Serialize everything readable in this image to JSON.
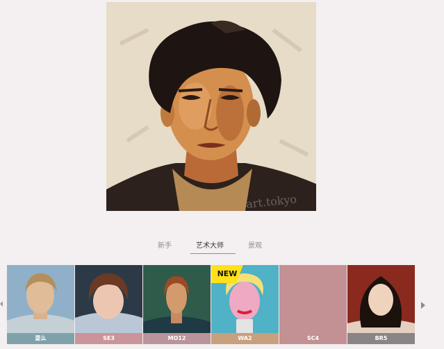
{
  "preview": {
    "signature": "art.tokyo"
  },
  "tabs": [
    {
      "label": "新手",
      "active": false
    },
    {
      "label": "艺术大师",
      "active": true
    },
    {
      "label": "景观",
      "active": false
    }
  ],
  "styles": [
    {
      "label": "耍么",
      "caption_color": "#7fa2aa",
      "badge": ""
    },
    {
      "label": "SE3",
      "caption_color": "#c9949a",
      "badge": ""
    },
    {
      "label": "MO12",
      "caption_color": "#b9949a",
      "badge": ""
    },
    {
      "label": "WA2",
      "caption_color": "#c8a07e",
      "badge": "NEW"
    },
    {
      "label": "SC4",
      "caption_color": "#c39093",
      "badge": ""
    },
    {
      "label": "BR5",
      "caption_color": "#8a8584",
      "badge": ""
    }
  ],
  "colors": {
    "accent": "#e26c62",
    "background": "#f4eff0"
  }
}
